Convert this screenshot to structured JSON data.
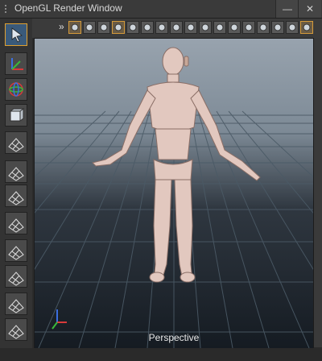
{
  "window": {
    "title": "OpenGL Render Window",
    "close_glyph": "✕",
    "minimize_glyph": "—"
  },
  "toolbar": {
    "overflow_glyph": "»",
    "icons": [
      "head-icon",
      "skeleton-icon",
      "rig-icon",
      "sphere-icon",
      "cube-icon",
      "sparkle-icon",
      "light-icon",
      "cube-shade-icon",
      "wave-icon",
      "camera-icon",
      "bone-icon",
      "ring-icon",
      "skull-icon",
      "wand-icon",
      "knife-icon",
      "stripes-icon",
      "grid-toggle-icon"
    ]
  },
  "left_toolbar": {
    "icons": [
      "select-arrow-icon",
      "axis-move-icon",
      "rotate-gizmo-icon",
      "cube-view-icon",
      "perspective-grid-icon",
      "two-view-icon",
      "floor-view-icon",
      "four-view-icon",
      "three-view-icon",
      "three-view-b-icon",
      "four-view-b-icon",
      "three-view-c-icon"
    ]
  },
  "viewport": {
    "label": "Perspective",
    "axis_x": "x",
    "axis_y": "y",
    "axis_z": "z"
  },
  "colors": {
    "accent": "#d49a3a",
    "grid": "#4b5a66",
    "figure": "#e2c8bf"
  }
}
